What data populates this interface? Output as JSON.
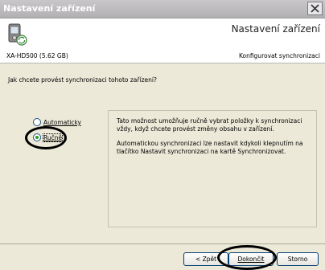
{
  "window": {
    "title": "Nastavení zařízení"
  },
  "header": {
    "title": "Nastavení zařízení",
    "device_name": "XA-HD500 (5.62 GB)",
    "subtitle": "Konfigurovat synchronizaci"
  },
  "content": {
    "question": "Jak chcete provést synchronizaci tohoto zařízení?",
    "options": [
      {
        "label": "Automaticky",
        "selected": false
      },
      {
        "label": "Ručně",
        "selected": true
      }
    ],
    "description": [
      "Tato možnost umožňuje ručně vybrat položky k synchronizaci vždy, když chcete provést změny obsahu v zařízení.",
      "Automatickou synchronizaci lze nastavit kdykoli klepnutím na tlačítko Nastavit synchronizaci na kartě Synchronizovat."
    ]
  },
  "buttons": {
    "back": "< Zpět",
    "finish": "Dokončit",
    "cancel": "Storno"
  },
  "colors": {
    "titlebar": "#b2b0b3",
    "content_bg": "#ece9d8",
    "radio_check": "#21a121"
  }
}
